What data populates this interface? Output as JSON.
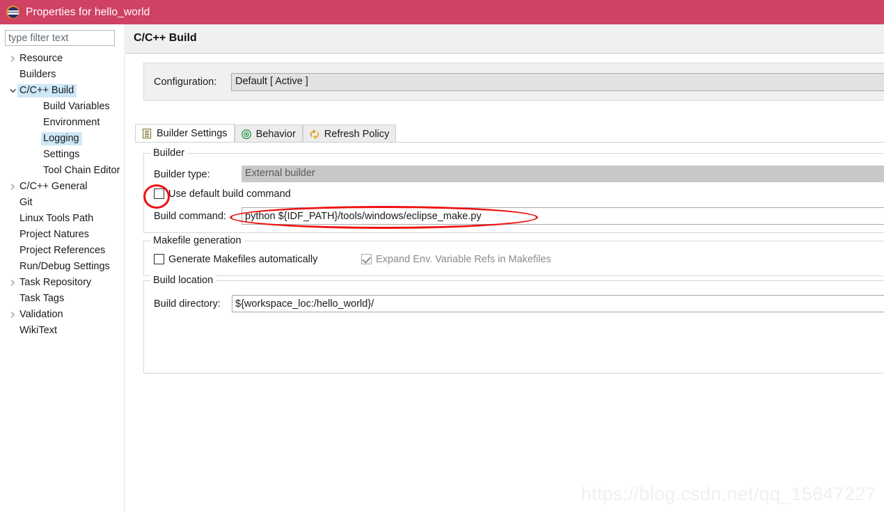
{
  "window": {
    "title": "Properties for hello_world",
    "icon": "eclipse-icon",
    "titlebar_color": "#cf4263"
  },
  "sidebar": {
    "filter": {
      "value": "",
      "placeholder": "type filter text"
    },
    "highlight_color": "#cde8f7",
    "items": [
      {
        "label": "Resource",
        "indent": 0,
        "arrow": "collapsed",
        "selected": false
      },
      {
        "label": "Builders",
        "indent": 0,
        "arrow": "none",
        "selected": false
      },
      {
        "label": "C/C++ Build",
        "indent": 0,
        "arrow": "expanded",
        "selected": true
      },
      {
        "label": "Build Variables",
        "indent": 1,
        "arrow": "none",
        "selected": false
      },
      {
        "label": "Environment",
        "indent": 1,
        "arrow": "none",
        "selected": false
      },
      {
        "label": "Logging",
        "indent": 1,
        "arrow": "none",
        "selected": true
      },
      {
        "label": "Settings",
        "indent": 1,
        "arrow": "none",
        "selected": false
      },
      {
        "label": "Tool Chain Editor",
        "indent": 1,
        "arrow": "none",
        "selected": false
      },
      {
        "label": "C/C++ General",
        "indent": 0,
        "arrow": "collapsed",
        "selected": false
      },
      {
        "label": "Git",
        "indent": 0,
        "arrow": "none",
        "selected": false
      },
      {
        "label": "Linux Tools Path",
        "indent": 0,
        "arrow": "none",
        "selected": false
      },
      {
        "label": "Project Natures",
        "indent": 0,
        "arrow": "none",
        "selected": false
      },
      {
        "label": "Project References",
        "indent": 0,
        "arrow": "none",
        "selected": false
      },
      {
        "label": "Run/Debug Settings",
        "indent": 0,
        "arrow": "none",
        "selected": false
      },
      {
        "label": "Task Repository",
        "indent": 0,
        "arrow": "collapsed",
        "selected": false
      },
      {
        "label": "Task Tags",
        "indent": 0,
        "arrow": "none",
        "selected": false
      },
      {
        "label": "Validation",
        "indent": 0,
        "arrow": "collapsed",
        "selected": false
      },
      {
        "label": "WikiText",
        "indent": 0,
        "arrow": "none",
        "selected": false
      }
    ]
  },
  "page": {
    "title": "C/C++ Build",
    "configuration": {
      "label": "Configuration:",
      "value": "Default  [ Active ]"
    },
    "tabs": [
      {
        "label": "Builder Settings",
        "icon": "list-lines-icon",
        "active": true
      },
      {
        "label": "Behavior",
        "icon": "target-circle-icon",
        "active": false
      },
      {
        "label": "Refresh Policy",
        "icon": "refresh-arrows-icon",
        "active": false
      }
    ],
    "builder_group": {
      "title": "Builder",
      "builder_type_label": "Builder type:",
      "builder_type_value": "External builder",
      "use_default_label": "Use default build command",
      "use_default_checked": false,
      "build_command_label": "Build command:",
      "build_command_value": "python ${IDF_PATH}/tools/windows/eclipse_make.py"
    },
    "makefile_group": {
      "title": "Makefile generation",
      "generate_label": "Generate Makefiles automatically",
      "generate_checked": false,
      "expand_label": "Expand Env. Variable Refs in Makefiles",
      "expand_checked": true,
      "expand_disabled": true
    },
    "build_location_group": {
      "title": "Build location",
      "build_dir_label": "Build directory:",
      "build_dir_value": "${workspace_loc:/hello_world}/"
    }
  },
  "annotations": {
    "color": "#ee1111",
    "shapes": [
      "ellipse-around-use-default-checkbox",
      "ellipse-around-build-command"
    ]
  },
  "watermark": {
    "text": "https://blog.csdn.net/qq_15647227"
  }
}
